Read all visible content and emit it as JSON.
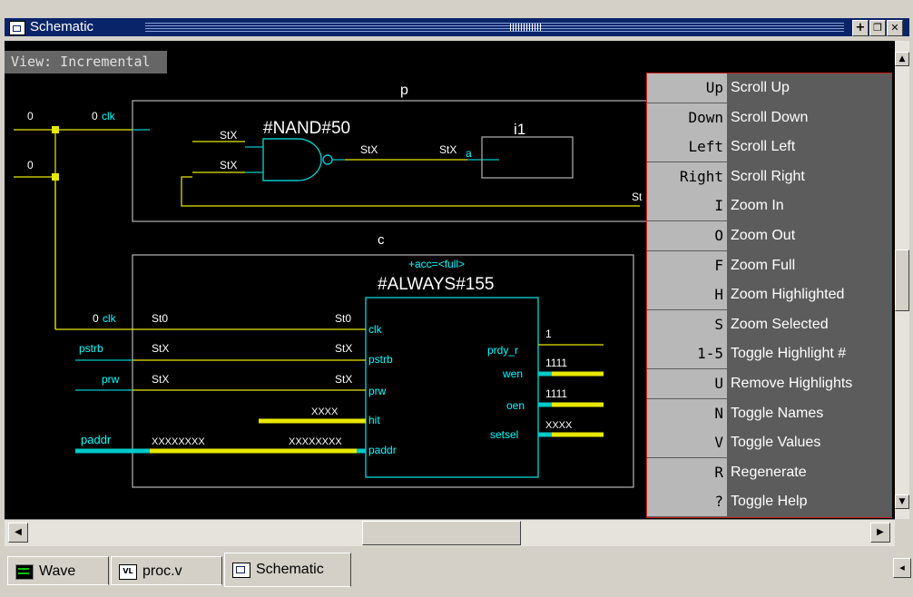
{
  "window": {
    "title": "Schematic",
    "buttons": [
      "+",
      "❐",
      "✕"
    ]
  },
  "view_mode": "View: Incremental",
  "schematic": {
    "blocks": [
      {
        "name": "p"
      },
      {
        "name": "c",
        "annotation": "+acc=<full>"
      }
    ],
    "instances": [
      "#NAND#50",
      "i1",
      "#ALWAYS#155"
    ],
    "left_signals": [
      "0",
      "0"
    ],
    "p_block": {
      "port_clk_value": "0",
      "port_clk": "clk",
      "nand_in1": "StX",
      "nand_in2": "StX",
      "nand_out": "StX",
      "i1_in_val": "StX",
      "i1_port": "a",
      "out_right": "St"
    },
    "c_block": {
      "in_ports": [
        {
          "outer_value": "0",
          "outer_port": "clk",
          "left_value": "St0",
          "right_value": "St0",
          "pin": "clk"
        },
        {
          "outer_port": "pstrb",
          "left_value": "StX",
          "right_value": "StX",
          "pin": "pstrb"
        },
        {
          "outer_port": "prw",
          "left_value": "StX",
          "right_value": "StX",
          "pin": "prw"
        },
        {
          "right_value": "XXXX",
          "pin": "hit"
        },
        {
          "outer_port": "paddr",
          "left_value": "XXXXXXXX",
          "right_value": "XXXXXXXX",
          "pin": "paddr"
        }
      ],
      "out_ports": [
        {
          "pin": "prdy_r",
          "value": "1"
        },
        {
          "pin": "wen",
          "value": "1111"
        },
        {
          "pin": "oen",
          "value": "1111"
        },
        {
          "pin": "setsel",
          "value": "XXXX"
        }
      ]
    }
  },
  "help": [
    {
      "key": "Up",
      "desc": "Scroll Up"
    },
    {
      "key": "Down",
      "desc": "Scroll Down"
    },
    {
      "key": "Left",
      "desc": "Scroll Left"
    },
    {
      "key": "Right",
      "desc": "Scroll Right"
    },
    {
      "key": "I",
      "desc": "Zoom In"
    },
    {
      "key": "O",
      "desc": "Zoom Out"
    },
    {
      "key": "F",
      "desc": "Zoom Full"
    },
    {
      "key": "H",
      "desc": "Zoom Highlighted"
    },
    {
      "key": "S",
      "desc": "Zoom Selected"
    },
    {
      "key": "1-5",
      "desc": "Toggle Highlight #"
    },
    {
      "key": "U",
      "desc": "Remove Highlights"
    },
    {
      "key": "N",
      "desc": "Toggle Names"
    },
    {
      "key": "V",
      "desc": "Toggle Values"
    },
    {
      "key": "R",
      "desc": "Regenerate"
    },
    {
      "key": "?",
      "desc": "Toggle Help"
    }
  ],
  "tabs": [
    {
      "label": "Wave",
      "icon": "wave-icon"
    },
    {
      "label": "proc.v",
      "icon": "verilog-file-icon",
      "icon_text": "VL"
    },
    {
      "label": "Schematic",
      "icon": "schematic-icon",
      "active": true
    }
  ],
  "colors": {
    "wire": "#e8e800",
    "net_label": "#00ffff",
    "component": "#00c8c8",
    "block_outline": "#b4b4b4",
    "value_text": "#ffffff",
    "help_key_bg": "#b8b8b8",
    "help_desc_bg": "#5c5c5c"
  }
}
